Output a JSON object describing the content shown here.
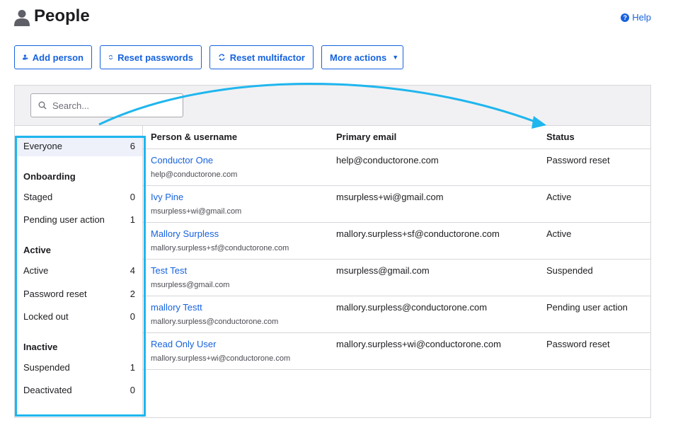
{
  "header": {
    "title": "People",
    "help_label": "Help"
  },
  "toolbar": {
    "add_person": "Add person",
    "reset_passwords": "Reset passwords",
    "reset_multifactor": "Reset multifactor",
    "more_actions": "More actions"
  },
  "search": {
    "placeholder": "Search...",
    "value": ""
  },
  "sidebar": {
    "everyone": {
      "label": "Everyone",
      "count": "6"
    },
    "onboarding_heading": "Onboarding",
    "staged": {
      "label": "Staged",
      "count": "0"
    },
    "pending": {
      "label": "Pending user action",
      "count": "1"
    },
    "active_heading": "Active",
    "active": {
      "label": "Active",
      "count": "4"
    },
    "password_reset": {
      "label": "Password reset",
      "count": "2"
    },
    "locked_out": {
      "label": "Locked out",
      "count": "0"
    },
    "inactive_heading": "Inactive",
    "suspended": {
      "label": "Suspended",
      "count": "1"
    },
    "deactivated": {
      "label": "Deactivated",
      "count": "0"
    }
  },
  "table": {
    "columns": [
      "Person & username",
      "Primary email",
      "Status"
    ],
    "rows": [
      {
        "name": "Conductor One",
        "username": "help@conductorone.com",
        "email": "help@conductorone.com",
        "status": "Password reset"
      },
      {
        "name": "Ivy Pine",
        "username": "msurpless+wi@gmail.com",
        "email": "msurpless+wi@gmail.com",
        "status": "Active"
      },
      {
        "name": "Mallory Surpless",
        "username": "mallory.surpless+sf@conductorone.com",
        "email": "mallory.surpless+sf@conductorone.com",
        "status": "Active"
      },
      {
        "name": "Test Test",
        "username": "msurpless@gmail.com",
        "email": "msurpless@gmail.com",
        "status": "Suspended"
      },
      {
        "name": "mallory Testt",
        "username": "mallory.surpless@conductorone.com",
        "email": "mallory.surpless@conductorone.com",
        "status": "Pending user action"
      },
      {
        "name": "Read Only User",
        "username": "mallory.surpless+wi@conductorone.com",
        "email": "mallory.surpless+wi@conductorone.com",
        "status": "Password reset"
      }
    ]
  },
  "annotation": {
    "color": "#1fb6ee"
  },
  "colors": {
    "accent": "#1662dd",
    "selected_bg": "#eef1fa"
  }
}
